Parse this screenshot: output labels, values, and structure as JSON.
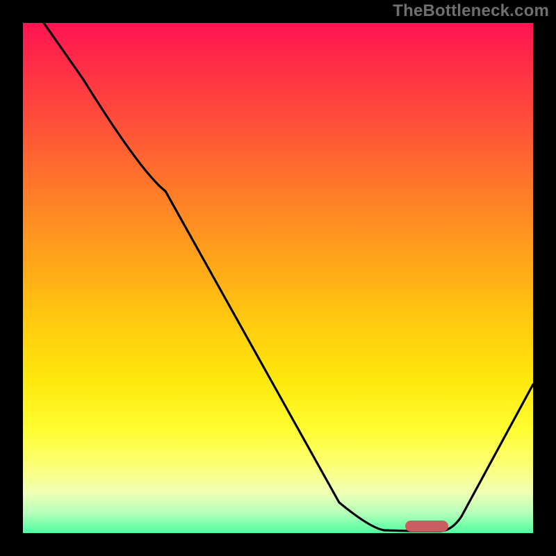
{
  "watermark": "TheBottleneck.com",
  "chart_data": {
    "type": "line",
    "title": "",
    "xlabel": "",
    "ylabel": "",
    "xlim": [
      0,
      100
    ],
    "ylim": [
      0,
      100
    ],
    "background_gradient": {
      "top": "#ff1450",
      "mid": "#ffe80c",
      "bottom": "#4cffa0",
      "note": "red-yellow-green vertical gradient, green at bottom"
    },
    "series": [
      {
        "name": "curve",
        "x": [
          4,
          12,
          20,
          28,
          62,
          70,
          76,
          82,
          100
        ],
        "y": [
          100,
          89,
          77,
          67,
          6,
          1,
          0,
          0,
          29
        ],
        "stroke": "#000000",
        "note": "black line descending steeply from top-left, flat minimum near x≈76-82, then rising to right edge"
      }
    ],
    "marker": {
      "shape": "rounded-bar",
      "color": "#cb5d60",
      "x_center": 79,
      "y": 0.5,
      "note": "small horizontal pink/red capsule at the curve's minimum"
    },
    "grid": false,
    "legend": false
  }
}
